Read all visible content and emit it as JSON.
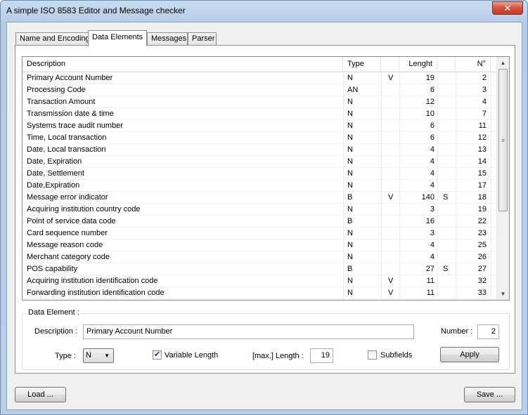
{
  "window": {
    "title": "A simple ISO 8583 Editor and Message checker",
    "close_glyph": "✕"
  },
  "tabs": [
    {
      "label": "Name and Encoding",
      "active": false
    },
    {
      "label": "Data Elements",
      "active": true
    },
    {
      "label": "Messages",
      "active": false
    },
    {
      "label": "Parser",
      "active": false
    }
  ],
  "table": {
    "columns": {
      "description": "Description",
      "type": "Type",
      "var": "",
      "length": "Lenght",
      "sub": "",
      "number": "N°"
    },
    "rows": [
      {
        "description": "Primary Account Number",
        "type": "N",
        "var": "V",
        "length": "19",
        "sub": "",
        "number": "2"
      },
      {
        "description": "Processing Code",
        "type": "AN",
        "var": "",
        "length": "6",
        "sub": "",
        "number": "3"
      },
      {
        "description": "Transaction Amount",
        "type": "N",
        "var": "",
        "length": "12",
        "sub": "",
        "number": "4"
      },
      {
        "description": "Transmission date & time",
        "type": "N",
        "var": "",
        "length": "10",
        "sub": "",
        "number": "7"
      },
      {
        "description": "Systems trace audit number",
        "type": "N",
        "var": "",
        "length": "6",
        "sub": "",
        "number": "11"
      },
      {
        "description": "Time, Local transaction",
        "type": "N",
        "var": "",
        "length": "6",
        "sub": "",
        "number": "12"
      },
      {
        "description": "Date, Local transaction",
        "type": "N",
        "var": "",
        "length": "4",
        "sub": "",
        "number": "13"
      },
      {
        "description": "Date, Expiration",
        "type": "N",
        "var": "",
        "length": "4",
        "sub": "",
        "number": "14"
      },
      {
        "description": "Date, Settlement",
        "type": "N",
        "var": "",
        "length": "4",
        "sub": "",
        "number": "15"
      },
      {
        "description": "Date,Expiration",
        "type": "N",
        "var": "",
        "length": "4",
        "sub": "",
        "number": "17"
      },
      {
        "description": "Message error indicator",
        "type": "B",
        "var": "V",
        "length": "140",
        "sub": "S",
        "number": "18"
      },
      {
        "description": "Acquiring institution country code",
        "type": "N",
        "var": "",
        "length": "3",
        "sub": "",
        "number": "19"
      },
      {
        "description": "Point of service data code",
        "type": "B",
        "var": "",
        "length": "16",
        "sub": "",
        "number": "22"
      },
      {
        "description": "Card sequence number",
        "type": "N",
        "var": "",
        "length": "3",
        "sub": "",
        "number": "23"
      },
      {
        "description": "Message reason code",
        "type": "N",
        "var": "",
        "length": "4",
        "sub": "",
        "number": "25"
      },
      {
        "description": "Merchant category code",
        "type": "N",
        "var": "",
        "length": "4",
        "sub": "",
        "number": "26"
      },
      {
        "description": "POS capability",
        "type": "B",
        "var": "",
        "length": "27",
        "sub": "S",
        "number": "27"
      },
      {
        "description": "Acquiring institution identification code",
        "type": "N",
        "var": "V",
        "length": "11",
        "sub": "",
        "number": "32"
      },
      {
        "description": "Forwarding institution identification code",
        "type": "N",
        "var": "V",
        "length": "11",
        "sub": "",
        "number": "33"
      }
    ],
    "scrollbar": {
      "up": "▲",
      "down": "▼",
      "grip": "≡"
    }
  },
  "data_element": {
    "legend": "Data Element :",
    "description_label": "Description :",
    "description_value": "Primary Account Number",
    "number_label": "Number :",
    "number_value": "2",
    "type_label": "Type :",
    "type_value": "N",
    "type_arrow": "▼",
    "variable_length_label": "Variable Length",
    "variable_length_checked": true,
    "max_length_label": "[max.] Length :",
    "max_length_value": "19",
    "subfields_label": "Subfields",
    "subfields_checked": false,
    "apply_label": "Apply"
  },
  "footer": {
    "load_label": "Load ...",
    "save_label": "Save ..."
  }
}
